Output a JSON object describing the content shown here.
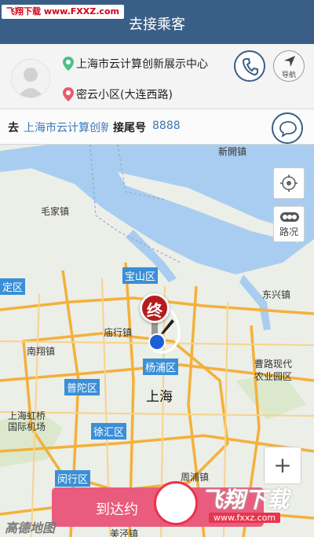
{
  "watermark_top": "飞翔下载 www.FXXZ.com",
  "header": {
    "title": "去接乘客"
  },
  "passenger": {
    "start_address": "上海市云计算创新展示中心",
    "end_address": "密云小区(大连西路)"
  },
  "actions": {
    "nav_label": "导航"
  },
  "destination_bar": {
    "go_label": "去",
    "place": "上海市云计算创新展示中心",
    "tail_label": "接尾号",
    "tail_number": "8888"
  },
  "map": {
    "labels": {
      "xinjiezhen": "新開镇",
      "maojiazhen": "毛家镇",
      "dongxingzhen": "东兴镇",
      "miaohangzhen": "庙行镇",
      "nanxiangzhen": "南翔镇",
      "caolu": "曹路现代",
      "caolu2": "农业园区",
      "hongqiao": "上海虹桥",
      "hongqiao2": "国际机场",
      "zhoupu": "周浦镇",
      "meijia": "美泾镇"
    },
    "districts": {
      "dingqu": "定区",
      "baoshan": "宝山区",
      "yangpu": "杨浦区",
      "putuo": "普陀区",
      "xuhui": "徐汇区",
      "minhang": "闵行区"
    },
    "city": "上海",
    "traffic_label": "路况",
    "zoom_in": "+",
    "end_marker": "终",
    "logo": "高德地图"
  },
  "arrive_button": {
    "label": "到达约"
  },
  "watermark_bottom": {
    "brand": "飞翔下载",
    "url": "www.fxxz.com"
  },
  "colors": {
    "header": "#3a5f86",
    "accent": "#3a78b8",
    "arrive": "#ea5c7d",
    "end_marker": "#b71c1c",
    "river": "#a9cdf0"
  }
}
